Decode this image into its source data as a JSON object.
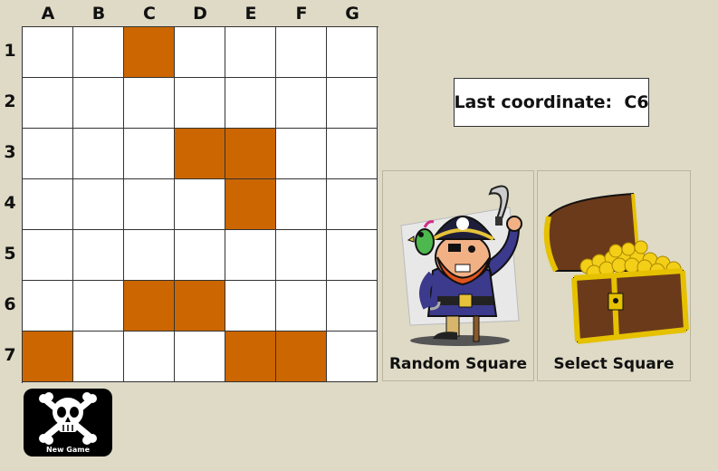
{
  "columns": [
    "A",
    "B",
    "C",
    "D",
    "E",
    "F",
    "G"
  ],
  "rows": [
    "1",
    "2",
    "3",
    "4",
    "5",
    "6",
    "7"
  ],
  "filled_cells": [
    "C1",
    "D3",
    "E3",
    "E4",
    "C6",
    "D6",
    "A7",
    "E7",
    "F7"
  ],
  "colors": {
    "filled": "#cc6600",
    "empty": "#ffffff",
    "background": "#dedac6"
  },
  "status": {
    "label": "Last coordinate:",
    "value": "C6"
  },
  "buttons": {
    "random_square": "Random Square",
    "select_square": "Select Square",
    "new_game": "New Game"
  },
  "icons": {
    "random_square": "pirate-with-parrot-icon",
    "select_square": "treasure-chest-icon",
    "new_game": "skull-crossbones-icon"
  }
}
